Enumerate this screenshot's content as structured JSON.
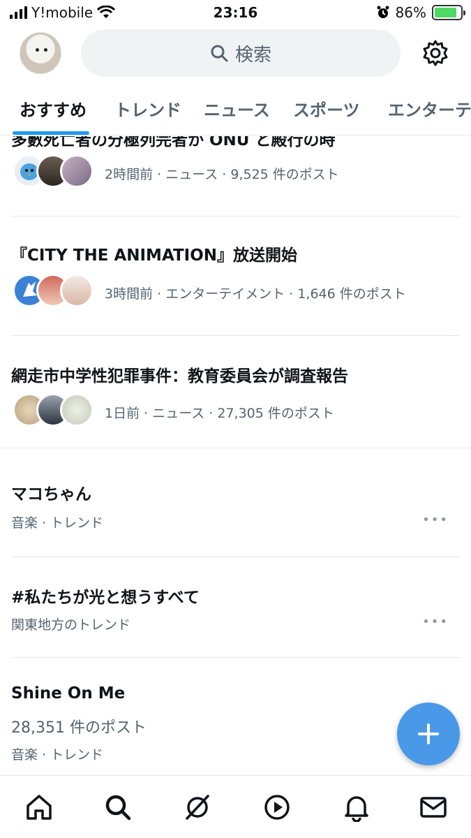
{
  "status": {
    "carrier": "Y!mobile",
    "time": "23:16",
    "battery": "86%",
    "battery_level": 0.86
  },
  "header": {
    "search_placeholder": "検索"
  },
  "tabs": [
    {
      "label": "おすすめ",
      "active": true
    },
    {
      "label": "トレンド",
      "active": false
    },
    {
      "label": "ニュース",
      "active": false
    },
    {
      "label": "スポーツ",
      "active": false
    },
    {
      "label": "エンターテ",
      "active": false
    }
  ],
  "feed": {
    "clipped_title": "多數死亡者の分極列完者か ONU と殿行の時",
    "news": [
      {
        "meta": "2時間前 · ニュース · 9,525 件のポスト"
      },
      {
        "title": "『CITY THE ANIMATION』放送開始",
        "meta": "3時間前 · エンターテイメント · 1,646 件のポスト"
      },
      {
        "title": "網走市中学性犯罪事件：教育委員会が調査報告",
        "meta": "1日前 · ニュース · 27,305 件のポスト"
      }
    ],
    "trends": [
      {
        "title": "マコちゃん",
        "context": "音楽 · トレンド",
        "more": "•••"
      },
      {
        "title": "#私たちが光と想うすべて",
        "context": "関東地方のトレンド",
        "more": "•••"
      },
      {
        "title": "Shine On Me",
        "count": "28,351 件のポスト",
        "context": "音楽 · トレンド"
      }
    ]
  },
  "colors": {
    "accent": "#1d9bf0",
    "fab": "#4a99e9",
    "secondary_text": "#536471"
  },
  "icons": [
    "home-icon",
    "search-icon",
    "grok-icon",
    "play-icon",
    "bell-icon",
    "mail-icon",
    "gear-icon",
    "plus-icon"
  ]
}
